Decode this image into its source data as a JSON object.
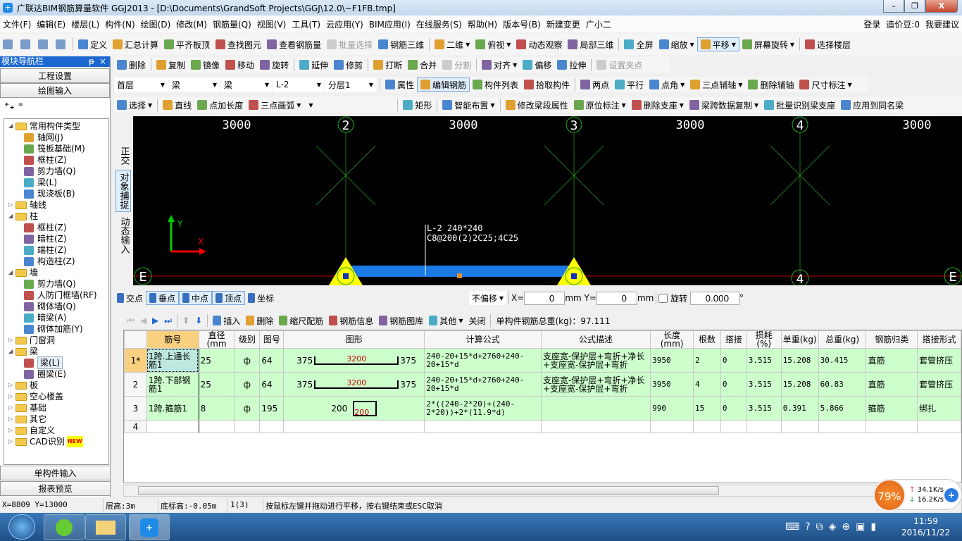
{
  "window": {
    "title": "广联达BIM钢筋算量软件 GGJ2013 - [D:\\Documents\\GrandSoft Projects\\GGJ\\12.0\\~F1FB.tmp]",
    "min": "–",
    "max": "❐",
    "close": "X"
  },
  "menu": [
    "文件(F)",
    "编辑(E)",
    "楼层(L)",
    "构件(N)",
    "绘图(D)",
    "修改(M)",
    "钢筋量(Q)",
    "视图(V)",
    "工具(T)",
    "云应用(Y)",
    "BIM应用(I)",
    "在线服务(S)",
    "帮助(H)",
    "版本号(B)",
    "新建变更",
    "广小二"
  ],
  "menu_right": [
    "登录",
    "造价豆:0",
    "我要建议"
  ],
  "toolbar1": [
    {
      "label": "定义",
      "icon": "define-icon"
    },
    {
      "label": "汇总计算",
      "icon": "sigma-icon"
    },
    {
      "label": "平齐板顶",
      "icon": "align-slab-icon"
    },
    {
      "label": "查找图元",
      "icon": "binoculars-icon"
    },
    {
      "label": "查看钢筋量",
      "icon": "view-rebar-icon"
    },
    {
      "label": "批量选择",
      "icon": "batch-select-icon",
      "disabled": true
    },
    {
      "label": "钢筋三维",
      "icon": "rebar-3d-icon"
    },
    {
      "label": "二维",
      "icon": "2d-icon",
      "dd": true
    },
    {
      "label": "俯视",
      "icon": "top-view-icon",
      "dd": true
    },
    {
      "label": "动态观察",
      "icon": "orbit-icon"
    },
    {
      "label": "局部三维",
      "icon": "partial-3d-icon"
    },
    {
      "label": "全屏",
      "icon": "fullscreen-icon"
    },
    {
      "label": "缩放",
      "icon": "zoom-icon",
      "dd": true
    },
    {
      "label": "平移",
      "icon": "pan-icon",
      "dd": true,
      "active": true
    },
    {
      "label": "屏幕旋转",
      "icon": "rotate-screen-icon",
      "dd": true
    },
    {
      "label": "选择楼层",
      "icon": "select-floor-icon"
    }
  ],
  "toolbar2": [
    {
      "label": "删除",
      "icon": "delete-icon"
    },
    {
      "label": "复制",
      "icon": "copy-icon"
    },
    {
      "label": "镜像",
      "icon": "mirror-icon"
    },
    {
      "label": "移动",
      "icon": "move-icon"
    },
    {
      "label": "旋转",
      "icon": "rotate-icon"
    },
    {
      "label": "延伸",
      "icon": "extend-icon"
    },
    {
      "label": "修剪",
      "icon": "trim-icon"
    },
    {
      "label": "打断",
      "icon": "break-icon"
    },
    {
      "label": "合并",
      "icon": "merge-icon"
    },
    {
      "label": "分割",
      "icon": "split-icon",
      "disabled": true
    },
    {
      "label": "对齐",
      "icon": "align-icon",
      "dd": true
    },
    {
      "label": "偏移",
      "icon": "offset-icon"
    },
    {
      "label": "拉伸",
      "icon": "stretch-icon"
    },
    {
      "label": "设置夹点",
      "icon": "grip-icon",
      "disabled": true
    }
  ],
  "selectors": [
    "首层",
    "梁",
    "梁",
    "L-2",
    "分层1"
  ],
  "toolbar3": [
    {
      "label": "属性",
      "icon": "properties-icon"
    },
    {
      "label": "编辑钢筋",
      "icon": "edit-rebar-icon",
      "active": true
    },
    {
      "label": "构件列表",
      "icon": "component-list-icon"
    },
    {
      "label": "拾取构件",
      "icon": "pick-icon"
    },
    {
      "label": "两点",
      "icon": "two-point-icon"
    },
    {
      "label": "平行",
      "icon": "parallel-icon"
    },
    {
      "label": "点角",
      "icon": "point-angle-icon",
      "dd": true
    },
    {
      "label": "三点辅轴",
      "icon": "three-point-axis-icon",
      "dd": true
    },
    {
      "label": "删除辅轴",
      "icon": "delete-axis-icon"
    },
    {
      "label": "尺寸标注",
      "icon": "dimension-icon",
      "dd": true
    }
  ],
  "toolbar4": [
    {
      "label": "选择",
      "icon": "cursor-icon",
      "dd": true
    },
    {
      "label": "直线",
      "icon": "line-icon"
    },
    {
      "label": "点加长度",
      "icon": "point-length-icon"
    },
    {
      "label": "三点画弧",
      "icon": "arc-icon",
      "dd": true
    },
    {
      "label": "",
      "icon": "blank",
      "dd": true
    },
    {
      "label": "矩形",
      "icon": "rectangle-icon"
    },
    {
      "label": "智能布置",
      "icon": "smart-layout-icon",
      "dd": true
    },
    {
      "label": "修改梁段属性",
      "icon": "modify-beam-icon"
    },
    {
      "label": "原位标注",
      "icon": "in-situ-label-icon",
      "dd": true
    },
    {
      "label": "删除支座",
      "icon": "delete-support-icon",
      "dd": true
    },
    {
      "label": "梁跨数据复制",
      "icon": "copy-span-icon",
      "dd": true
    },
    {
      "label": "批量识别梁支座",
      "icon": "identify-support-icon"
    },
    {
      "label": "应用到同名梁",
      "icon": "apply-same-icon"
    }
  ],
  "nav": {
    "title": "模块导航栏",
    "pin": "ᵽ",
    "close": "×",
    "project_settings": "工程设置",
    "drawing_input": "绘图输入",
    "single_input": "单构件输入",
    "report_preview": "报表预览",
    "tree": [
      {
        "label": "常用构件类型",
        "level": 0,
        "folder": true,
        "open": true
      },
      {
        "label": "轴网(J)",
        "level": 1
      },
      {
        "label": "筏板基础(M)",
        "level": 1
      },
      {
        "label": "框柱(Z)",
        "level": 1
      },
      {
        "label": "剪力墙(Q)",
        "level": 1
      },
      {
        "label": "梁(L)",
        "level": 1
      },
      {
        "label": "现浇板(B)",
        "level": 1
      },
      {
        "label": "轴线",
        "level": 0,
        "folder": true
      },
      {
        "label": "柱",
        "level": 0,
        "folder": true,
        "open": true
      },
      {
        "label": "框柱(Z)",
        "level": 1
      },
      {
        "label": "暗柱(Z)",
        "level": 1
      },
      {
        "label": "端柱(Z)",
        "level": 1
      },
      {
        "label": "构造柱(Z)",
        "level": 1
      },
      {
        "label": "墙",
        "level": 0,
        "folder": true,
        "open": true
      },
      {
        "label": "剪力墙(Q)",
        "level": 1
      },
      {
        "label": "人防门框墙(RF)",
        "level": 1
      },
      {
        "label": "砌体墙(Q)",
        "level": 1
      },
      {
        "label": "暗梁(A)",
        "level": 1
      },
      {
        "label": "砌体加筋(Y)",
        "level": 1
      },
      {
        "label": "门窗洞",
        "level": 0,
        "folder": true
      },
      {
        "label": "梁",
        "level": 0,
        "folder": true,
        "open": true
      },
      {
        "label": "梁(L)",
        "level": 1,
        "selected": true
      },
      {
        "label": "圈梁(E)",
        "level": 1
      },
      {
        "label": "板",
        "level": 0,
        "folder": true
      },
      {
        "label": "空心楼盖",
        "level": 0,
        "folder": true
      },
      {
        "label": "基础",
        "level": 0,
        "folder": true
      },
      {
        "label": "其它",
        "level": 0,
        "folder": true
      },
      {
        "label": "自定义",
        "level": 0,
        "folder": true
      },
      {
        "label": "CAD识别",
        "level": 0,
        "folder": true,
        "badge": "NEW"
      }
    ]
  },
  "side_tools": [
    "正交",
    "对象捕捉",
    "动态输入"
  ],
  "canvas": {
    "dims": [
      "3000",
      "3000",
      "3000",
      "3000"
    ],
    "axes": [
      "2",
      "3",
      "4"
    ],
    "row_axis": "E",
    "bottom_axis": "4",
    "beam_label1": "L-2 240*240",
    "beam_label2": "C8@200(2)2C25;4C25",
    "axis_y": "Y",
    "axis_x": "X",
    "colors": {
      "beam": "#1a7ae6",
      "support": "#ffff00",
      "axisline": "#c00000",
      "grid": "#22aa22"
    }
  },
  "snap": {
    "items": [
      "交点",
      "垂点",
      "中点",
      "顶点",
      "坐标"
    ],
    "offset": "不偏移",
    "x_label": "X=",
    "x_value": "0",
    "y_label": "Y=",
    "y_value": "0",
    "unit": "mm",
    "rotate": "旋转",
    "rotate_value": "0.000",
    "degree": "°"
  },
  "rebar_toolbar": {
    "items": [
      "插入",
      "删除",
      "缩尺配筋",
      "钢筋信息",
      "钢筋图库",
      "其他",
      "关闭"
    ],
    "total": "单构件钢筋总重(kg)：97.111"
  },
  "table": {
    "headers": [
      "",
      "筋号",
      "直径(mm",
      "级别",
      "图号",
      "图形",
      "计算公式",
      "公式描述",
      "长度(mm)",
      "根数",
      "搭接",
      "损耗(%)",
      "单重(kg)",
      "总重(kg)",
      "钢筋归类",
      "搭接形式"
    ],
    "rows": [
      {
        "no": "1*",
        "name": "1跨.上通长筋1",
        "dia": "25",
        "grade": "ф",
        "fig": "64",
        "shape": {
          "left": "375",
          "mid": "3200",
          "right": "375"
        },
        "formula": "240-20+15*d+2760+240-20+15*d",
        "desc": "支座宽-保护层+弯折+净长+支座宽-保护层+弯折",
        "length": "3950",
        "count": "2",
        "lap": "0",
        "loss": "3.515",
        "unit_w": "15.208",
        "total_w": "30.415",
        "cat": "直筋",
        "lap_type": "套管挤压"
      },
      {
        "no": "2",
        "name": "1跨.下部钢筋1",
        "dia": "25",
        "grade": "ф",
        "fig": "64",
        "shape": {
          "left": "375",
          "mid": "3200",
          "right": "375"
        },
        "formula": "240-20+15*d+2760+240-20+15*d",
        "desc": "支座宽-保护层+弯折+净长+支座宽-保护层+弯折",
        "length": "3950",
        "count": "4",
        "lap": "0",
        "loss": "3.515",
        "unit_w": "15.208",
        "total_w": "60.83",
        "cat": "直筋",
        "lap_type": "套管挤压"
      },
      {
        "no": "3",
        "name": "1跨.箍筋1",
        "dia": "8",
        "grade": "ф",
        "fig": "195",
        "shape": {
          "left": "200",
          "mid": "200",
          "stirrup": true
        },
        "formula": "2*((240-2*20)+(240-2*20))+2*(11.9*d)",
        "desc": "",
        "length": "990",
        "count": "15",
        "lap": "0",
        "loss": "3.515",
        "unit_w": "0.391",
        "total_w": "5.866",
        "cat": "箍筋",
        "lap_type": "绑扎"
      }
    ],
    "empty_row": "4"
  },
  "status": [
    "X=8809 Y=13000",
    "层高:3m",
    "底标高:-0.05m",
    "1(3)",
    "按鼠标左键并拖动进行平移，按右键结束或ESC取消"
  ],
  "tray": {
    "cpu": "79%",
    "up": "34.1K/s",
    "down": "16.2K/s",
    "time": "11:59",
    "date": "2016/11/22"
  }
}
